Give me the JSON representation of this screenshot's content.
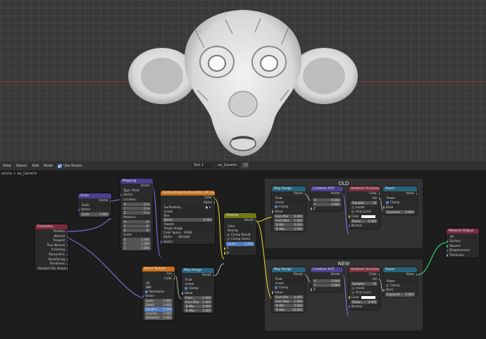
{
  "header": {
    "menu": [
      "View",
      "Select",
      "Add",
      "Node"
    ],
    "use_nodes": "Use Nodes",
    "slot": "Slot 1",
    "material": "aa_Generic",
    "users": "12"
  },
  "breadcrumb": "zanne  >  aa_Generic",
  "frames": {
    "old": "OLD",
    "new": "NEW"
  },
  "nodes": {
    "geometry": {
      "title": "Geometry",
      "outputs": [
        "Position",
        "Normal",
        "Tangent",
        "True Normal",
        "Incoming",
        "Parametric",
        "Backfacing",
        "Pointiness",
        "Random Per Island"
      ]
    },
    "scale": {
      "title": "Scale",
      "out": "Vector",
      "mode": "Scale",
      "vector": "Vector",
      "scale_label": "Scale",
      "scale_value": "5.000"
    },
    "mapping": {
      "title": "Mapping",
      "out": "Vector",
      "type_label": "Type:",
      "type_value": "Point",
      "vector": "Vector",
      "location": "Location:",
      "rotation": "Rotation:",
      "scale": "Scale:",
      "loc": [
        {
          "a": "X",
          "v": "0 m"
        },
        {
          "a": "Y",
          "v": "0 m"
        },
        {
          "a": "Z",
          "v": "0 m"
        }
      ],
      "rot": [
        {
          "a": "X",
          "v": "0°"
        },
        {
          "a": "Y",
          "v": "0°"
        },
        {
          "a": "Z",
          "v": "0°"
        }
      ],
      "scl": [
        {
          "a": "X",
          "v": "1.000"
        },
        {
          "a": "Y",
          "v": "1.000"
        },
        {
          "a": "Z",
          "v": "1.000"
        }
      ]
    },
    "image": {
      "title": "SurfaceImperfections003_4K_var1.jpg",
      "out_color": "Color",
      "out_alpha": "Alpha",
      "image_name": "SurfaceImp...",
      "interp": "Linear",
      "proj": "Box",
      "blend_label": "Blend",
      "blend_value": "0.200",
      "ext": "Repeat",
      "source": "Single Image",
      "cs_label": "Color Space",
      "cs_value": "sRGB",
      "alpha_label": "Alpha",
      "alpha_value": "Straight",
      "vector": "Vector"
    },
    "noise": {
      "title": "Noise Texture",
      "out_fac": "Fac",
      "out_color": "Color",
      "dim": "2D",
      "type": "fBM",
      "normalize": "Normalize",
      "vector": "Vector",
      "fields": [
        {
          "l": "Scale",
          "v": "1.000"
        },
        {
          "l": "Detail",
          "v": "2.000"
        },
        {
          "l": "Roughn...",
          "v": "0.500"
        },
        {
          "l": "Lacunar...",
          "v": "2.000"
        },
        {
          "l": "Distortion",
          "v": "0.000"
        }
      ]
    },
    "maprange_mid": {
      "title": "Map Range",
      "out": "Result",
      "dtype": "Float",
      "interp": "Linear",
      "clamp": "Clamp",
      "value": "Value",
      "fields": [
        {
          "l": "From ...",
          "v": "-1.000"
        },
        {
          "l": "From Max",
          "v": "1.000"
        },
        {
          "l": "To Min",
          "v": "0.000"
        },
        {
          "l": "To Max",
          "v": "2.000"
        }
      ]
    },
    "overlay": {
      "title": "Overlay",
      "out": "Result",
      "dtype": "Color",
      "blend": "Overlay",
      "clamp_result": "Clamp Result",
      "clamp_factor": "Clamp Factor",
      "factor_label": "Factor",
      "factor_value": "1.000",
      "in_a": "A",
      "in_b": "B"
    },
    "old_maprange": {
      "title": "Map Range",
      "out": "Result",
      "dtype": "Float",
      "interp": "Linear",
      "clamp": "Clamp",
      "value": "Value",
      "fields": [
        {
          "l": "From Min",
          "v": "0.000"
        },
        {
          "l": "From Max",
          "v": "1.000"
        },
        {
          "l": "To Min",
          "v": "0.000"
        },
        {
          "l": "To Max",
          "v": "2.000"
        }
      ]
    },
    "old_combine": {
      "title": "Combine XYZ",
      "out": "Vector",
      "fields": [
        {
          "l": "X",
          "v": "0.000"
        },
        {
          "l": "Y",
          "v": "0.000"
        }
      ],
      "z": "Z"
    },
    "old_ao": {
      "title": "Ambient Occlusion",
      "out_color": "Color",
      "out_ao": "AO",
      "samples_label": "Samples",
      "samples_value": "16",
      "inside": "Inside",
      "only_local": "Only Local",
      "color": "Color",
      "dist_label": "Distan...",
      "dist_value": "2.000",
      "normal": "Normal"
    },
    "old_power": {
      "title": "Power",
      "out": "Value",
      "op": "Power",
      "clamp": "Clamp",
      "base": "Base",
      "exp_label": "Exponent",
      "exp_value": "5.000"
    },
    "new_maprange": {
      "title": "Map Range",
      "out": "Result",
      "dtype": "Float",
      "interp": "Linear",
      "clamp": "Clamp",
      "value": "Value",
      "fields": [
        {
          "l": "From Min",
          "v": "0.000"
        },
        {
          "l": "From Max",
          "v": "1.000"
        },
        {
          "l": "To Min",
          "v": "0.000"
        },
        {
          "l": "To Max",
          "v": "20.000"
        }
      ]
    },
    "new_combine": {
      "title": "Combine XYZ",
      "out": "Vector",
      "fields": [
        {
          "l": "X",
          "v": "0.000"
        },
        {
          "l": "Y",
          "v": "0.000"
        }
      ],
      "z": "Z"
    },
    "new_ao": {
      "title": "Ambient Occlusion",
      "out_color": "Color",
      "out_ao": "AO",
      "samples_label": "Samples",
      "samples_value": "16",
      "inside": "Inside",
      "only_local": "Only Local",
      "color": "Color",
      "dist_label": "Distan...",
      "dist_value": "0.400",
      "normal": "Normal"
    },
    "new_power": {
      "title": "Power",
      "out": "Value",
      "op": "Power",
      "clamp": "Clamp",
      "base": "Base",
      "exp_label": "Exponent",
      "exp_value": "5.000"
    },
    "output": {
      "title": "Material Output",
      "target": "All",
      "inputs": [
        "Surface",
        "Volume",
        "Displacement",
        "Thickness"
      ]
    }
  },
  "colors": {
    "vector_header": "#4b3f91",
    "texture_header": "#c2701f",
    "input_header": "#7d2a3e",
    "color_header": "#6f7a16",
    "converter_header": "#27637e",
    "shader_header": "#2d7a3f",
    "output_header": "#7d2a3e",
    "wire": "#7a68c8",
    "wire_gray": "#9a9a9a",
    "wire_yellow": "#c6c630",
    "socket_vector": "#6464c8",
    "socket_float": "#a1a1a1",
    "socket_color": "#c7c729",
    "socket_shader": "#39c774"
  }
}
